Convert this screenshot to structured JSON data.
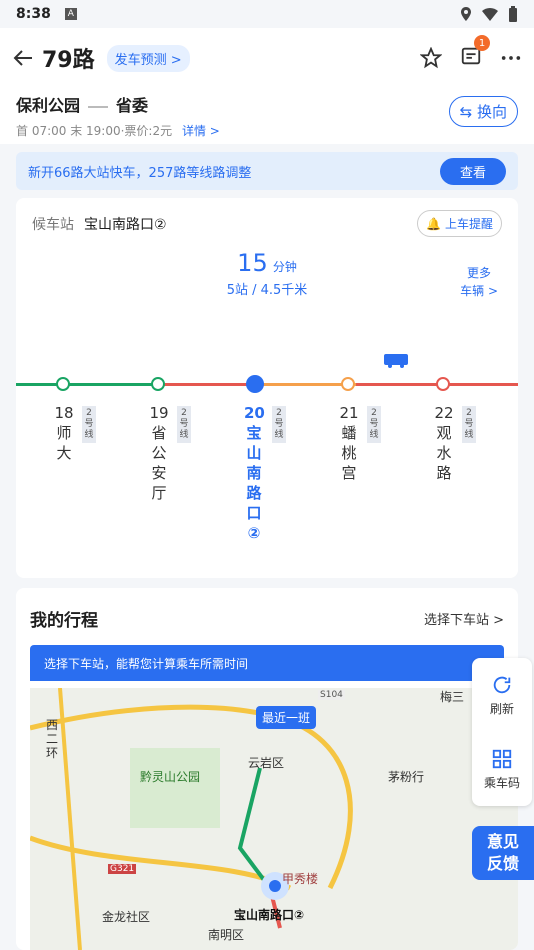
{
  "status": {
    "time": "8:38",
    "a_label": "A"
  },
  "header": {
    "route": "79路",
    "forecast": "发车预测 >",
    "badge": "1"
  },
  "route": {
    "from": "保利公园",
    "to": "省委",
    "meta": "首 07:00 末 19:00·票价:2元",
    "detail": "详情 >",
    "swap": "⇆ 换向"
  },
  "notice": {
    "text": "新开66路大站快车，257路等线路调整",
    "button": "查看"
  },
  "waiting": {
    "label": "候车站",
    "stop": "宝山南路口②",
    "remind": "上车提醒"
  },
  "eta": {
    "minutes": "15",
    "unit": "分钟",
    "sub": "5站 / 4.5千米",
    "more": "更多",
    "more2": "车辆 >"
  },
  "stops": [
    {
      "num": "18",
      "name": "师大",
      "tag": "2号线"
    },
    {
      "num": "19",
      "name": "省公安厅",
      "tag": "2号线"
    },
    {
      "num": "20",
      "name": "宝山南路口②",
      "tag": "2号线"
    },
    {
      "num": "21",
      "name": "蟠桃宫",
      "tag": "2号线"
    },
    {
      "num": "22",
      "name": "观水路",
      "tag": "2号线"
    }
  ],
  "trip": {
    "title": "我的行程",
    "select": "选择下车站 >",
    "banner": "选择下车站，能帮您计算乘车所需时间"
  },
  "map": {
    "latest_bus": "最近一班",
    "road_s104": "S104",
    "yunyan": "云岩区",
    "qianlingshan": "黔灵山公园",
    "west_ring": "西二环",
    "maofen": "茅粉行",
    "g321": "G321",
    "jinlong": "金龙社区",
    "nanming": "南明区",
    "station": "宝山南路口②",
    "jiaxiu": "甲秀楼",
    "meisan": "梅三"
  },
  "side": {
    "refresh": "刷新",
    "code": "乘车码"
  },
  "feedback": {
    "line1": "意见",
    "line2": "反馈"
  },
  "colors": {
    "accent": "#2a6ef0",
    "green_line": "#19a463",
    "red_line": "#e5574f",
    "orange_line": "#f5a04b"
  }
}
